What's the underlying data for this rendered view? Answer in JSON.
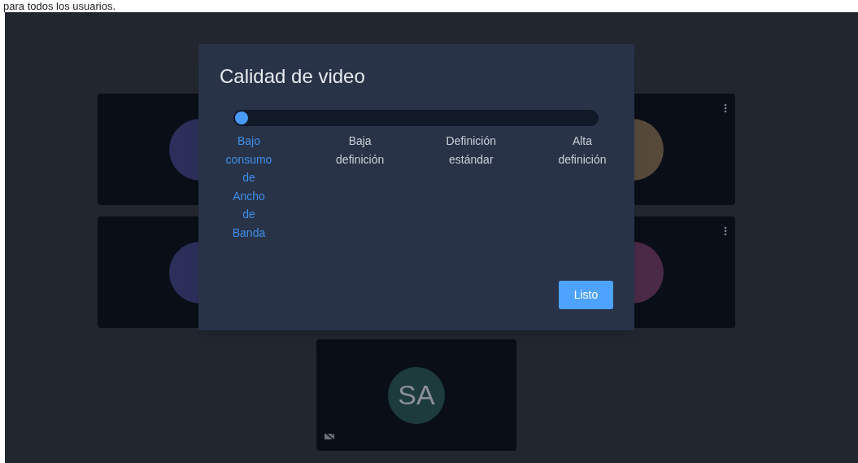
{
  "page_text": "para todos los usuarios.",
  "tile_rows": [
    {
      "tiles": [
        {
          "color": "#2b2f5a",
          "menu": false,
          "camera_off": false
        },
        {
          "color": "#57493a",
          "menu": true,
          "camera_off": false
        }
      ]
    },
    {
      "tiles": [
        {
          "color": "#2b2f5a",
          "menu": false,
          "camera_off": false
        },
        {
          "color": "#4b2a47",
          "menu": true,
          "camera_off": false
        }
      ]
    },
    {
      "tiles": [
        {
          "initials": "SA",
          "color": "#1d3b3c",
          "menu": false,
          "camera_off": true
        }
      ]
    }
  ],
  "dialog": {
    "title": "Calidad de video",
    "slider": {
      "level": 0
    },
    "quality_options": [
      {
        "label": "Bajo consumo de Ancho de Banda",
        "selected": true
      },
      {
        "label": "Baja definición",
        "selected": false
      },
      {
        "label": "Definición estándar",
        "selected": false
      },
      {
        "label": "Alta definición",
        "selected": false
      }
    ],
    "done_button": "Listo"
  }
}
